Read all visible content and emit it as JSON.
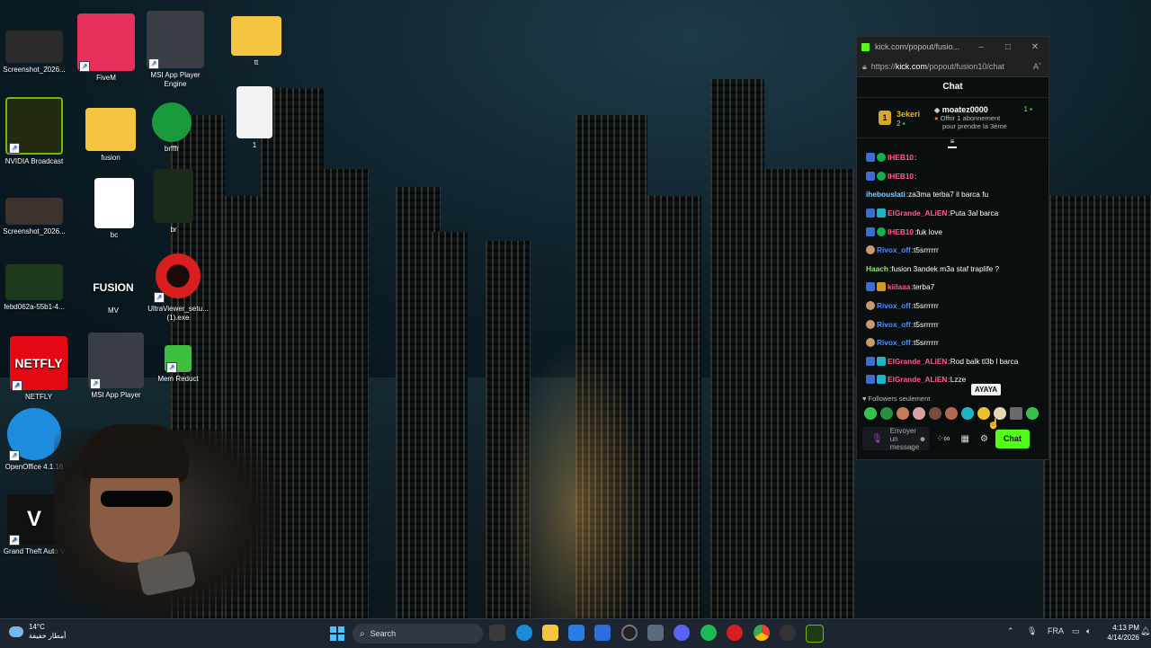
{
  "desktop": {
    "icons": [
      {
        "label": "Screenshot_2026..."
      },
      {
        "label": "FiveM"
      },
      {
        "label": "MSI App Player Engine"
      },
      {
        "label": "tt"
      },
      {
        "label": "NVIDIA Broadcast"
      },
      {
        "label": "fusion"
      },
      {
        "label": "brfffr"
      },
      {
        "label": "1"
      },
      {
        "label": "Screenshot_2026..."
      },
      {
        "label": "bc"
      },
      {
        "label": "br"
      },
      {
        "label": "febd062a-55b1-4..."
      },
      {
        "label": "MV"
      },
      {
        "label": "UltraViewer_setu... (1).exe"
      },
      {
        "label": "NETFLY"
      },
      {
        "label": "MSI App Player"
      },
      {
        "label": "Mem Reduct"
      },
      {
        "label": "OpenOffice 4.1.16"
      },
      {
        "label": "Grand Theft Auto V"
      }
    ],
    "icon_text": {
      "fusion_tv": "FUSION",
      "netfly": "NETFLY",
      "msi": "msi",
      "gta": "V"
    }
  },
  "chat_window": {
    "title": "kick.com/popout/fusio...",
    "url_prefix": "https://",
    "url_domain": "kick.com",
    "url_path": "/popout/fusion10/chat",
    "reader_glyph": "Aˆ",
    "header": "Chat",
    "gifters": {
      "first_rank": "1",
      "first_name": "3ekeri",
      "first_count": "2",
      "second_name": "moatez0000",
      "second_count": "1",
      "offer_line1": "Offrir 1 abonnement",
      "offer_line2": "pour prendre la 3ème"
    },
    "messages": [
      {
        "user": "IHEB10",
        "color": "#ff5c8a",
        "badges": [
          "blue",
          "green"
        ],
        "text": ""
      },
      {
        "user": "IHEB10",
        "color": "#ff5c8a",
        "badges": [
          "blue",
          "green"
        ],
        "text": ""
      },
      {
        "user": "ihebouslati",
        "color": "#7fd3ff",
        "badges": [],
        "text": "za3ma terba7 il barca fu"
      },
      {
        "user": "ElGrande_ALiEN",
        "color": "#ff5c8a",
        "badges": [
          "blue",
          "cyan"
        ],
        "text": "Puta 3al barca"
      },
      {
        "user": "IHEB10",
        "color": "#ff5c8a",
        "badges": [
          "blue",
          "green"
        ],
        "text": "fuk love"
      },
      {
        "user": "Rivox_off",
        "color": "#4f8cff",
        "badges": [
          "face"
        ],
        "text": "t5srrrrrr"
      },
      {
        "user": "Haach",
        "color": "#8ef05a",
        "badges": [],
        "text": "fusion 3andek m3a staf traplife ?"
      },
      {
        "user": "kiilaaa",
        "color": "#ff5c8a",
        "badges": [
          "blue",
          "gold"
        ],
        "text": "terba7"
      },
      {
        "user": "Rivox_off",
        "color": "#4f8cff",
        "badges": [
          "face"
        ],
        "text": "t5srrrrrr"
      },
      {
        "user": "Rivox_off",
        "color": "#4f8cff",
        "badges": [
          "face"
        ],
        "text": "t5srrrrrr"
      },
      {
        "user": "Rivox_off",
        "color": "#4f8cff",
        "badges": [
          "face"
        ],
        "text": "t5srrrrrr"
      },
      {
        "user": "ElGrande_ALiEN",
        "color": "#ff5c8a",
        "badges": [
          "blue",
          "cyan"
        ],
        "text": "Rod balk tl3b l barca"
      },
      {
        "user": "ElGrande_ALiEN",
        "color": "#ff5c8a",
        "badges": [
          "blue",
          "cyan"
        ],
        "text": "Lzze"
      }
    ],
    "followers_only": "Followers seulement",
    "emote_tooltip": "AYAYA",
    "input_placeholder": "Envoyer un message",
    "send_label": "Chat",
    "accent": "#53fc18"
  },
  "taskbar": {
    "temperature": "14°C",
    "weather_text": "أمطار خفيفة",
    "search_placeholder": "Search",
    "language": "FRA",
    "time": "4:13 PM",
    "date": "4/14/2026"
  }
}
